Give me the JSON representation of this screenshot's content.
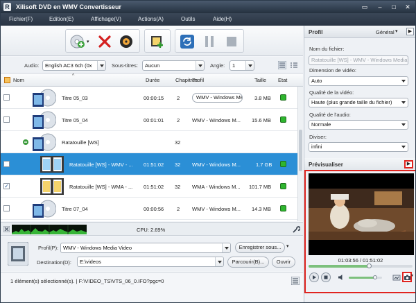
{
  "window": {
    "title": "Xilisoft DVD en WMV Convertisseur",
    "logo_letter": "R"
  },
  "menu": [
    "Fichier(F)",
    "Edition(E)",
    "Affichage(V)",
    "Actions(A)",
    "Outils",
    "Aide(H)"
  ],
  "settings": {
    "audio_label": "Audio:",
    "audio_value": "English AC3 6ch (0x",
    "subtitles_label": "Sous-titres:",
    "subtitles_value": "Aucun",
    "angle_label": "Angle:",
    "angle_value": "1"
  },
  "columns": {
    "name": "Nom",
    "duration": "Durée",
    "chapters": "Chapitres",
    "profile": "Profil",
    "size": "Taille",
    "state": "Etat"
  },
  "rows": [
    {
      "name": "Titre 05_03",
      "duration": "00:00:15",
      "chapters": "2",
      "profile": "WMV - Windows Media",
      "size": "3.8 MB",
      "checked": false,
      "selected": false,
      "group": false
    },
    {
      "name": "Titre 05_04",
      "duration": "00:01:01",
      "chapters": "2",
      "profile": "WMV - Windows M...",
      "size": "15.6 MB",
      "checked": false,
      "selected": false,
      "group": false
    },
    {
      "name": "Ratatouille [WS]",
      "duration": "",
      "chapters": "32",
      "profile": "",
      "size": "",
      "checked": false,
      "selected": false,
      "group": true
    },
    {
      "name": "Ratatouille [WS] - WMV - ...",
      "duration": "01:51:02",
      "chapters": "32",
      "profile": "WMV - Windows M...",
      "size": "1.7 GB",
      "checked": false,
      "selected": true,
      "group": false
    },
    {
      "name": "Ratatouille [WS] - WMA - ...",
      "duration": "01:51:02",
      "chapters": "32",
      "profile": "WMA - Windows M...",
      "size": "101.7 MB",
      "checked": true,
      "selected": false,
      "group": false
    },
    {
      "name": "Titre 07_04",
      "duration": "00:00:56",
      "chapters": "2",
      "profile": "WMV - Windows M...",
      "size": "14.3 MB",
      "checked": false,
      "selected": false,
      "group": false
    }
  ],
  "cpu": {
    "label": "CPU: 2.69%"
  },
  "output": {
    "profile_label": "Profil(P):",
    "profile_value": "WMV - Windows Media Video",
    "save_as": "Enregistrer sous...",
    "destination_label": "Destination(D):",
    "destination_value": "E:\\videos",
    "browse": "Parcourir(B)...",
    "open": "Ouvrir"
  },
  "status": {
    "text": "1 élément(s) sélectionné(s). | F:\\VIDEO_TS\\VTS_06_0.IFO?pgc=0"
  },
  "panel": {
    "title": "Profil",
    "mode": "Général",
    "filename_label": "Nom du fichier:",
    "filename_value": "Ratatouille [WS] - WMV - Windows Media",
    "video_size_label": "Dimension de vidéo:",
    "video_size_value": "Auto",
    "video_quality_label": "Qualité de la vidéo:",
    "video_quality_value": "Haute (plus grande taille du fichier)",
    "audio_quality_label": "Qualité de l'audio:",
    "audio_quality_value": "Normale",
    "split_label": "Diviser:",
    "split_value": "infini"
  },
  "preview": {
    "title": "Prévisualiser",
    "time": "01:03:56 / 01:51:02",
    "progress": 0.58,
    "volume": 0.8
  },
  "colors": {
    "accent": "#2b8fd6",
    "highlight": "#e0241f",
    "ok": "#2fb52f"
  }
}
